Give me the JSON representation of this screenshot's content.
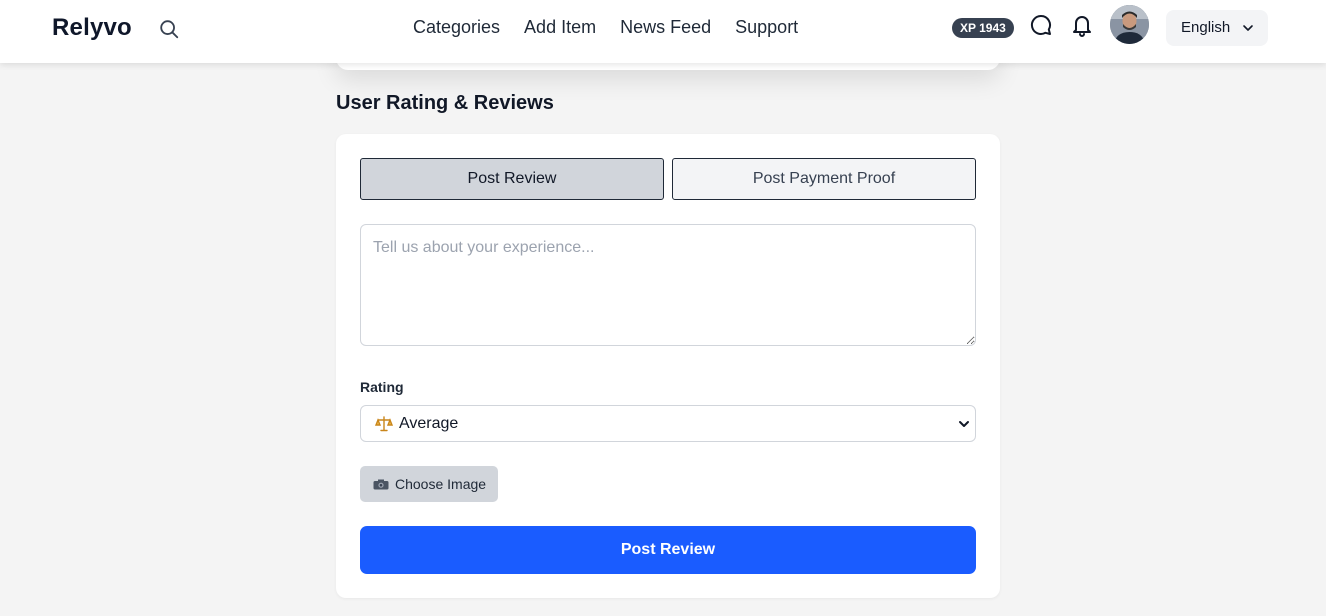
{
  "brand": {
    "name": "Relyvo"
  },
  "nav": {
    "links": [
      "Categories",
      "Add Item",
      "News Feed",
      "Support"
    ]
  },
  "header": {
    "xp_badge": "XP 1943",
    "language": "English"
  },
  "section": {
    "title": "User Rating & Reviews"
  },
  "tabs": {
    "post_review": "Post Review",
    "post_payment_proof": "Post Payment Proof"
  },
  "form": {
    "review_placeholder": "Tell us about your experience...",
    "rating_label": "Rating",
    "rating_selected": "Average",
    "rating_emoji": "balance-scale-icon",
    "choose_image_label": "Choose Image",
    "submit_label": "Post Review"
  },
  "colors": {
    "primary": "#1a5cff",
    "badge_bg": "#374151",
    "page_bg": "#f4f4f4"
  }
}
